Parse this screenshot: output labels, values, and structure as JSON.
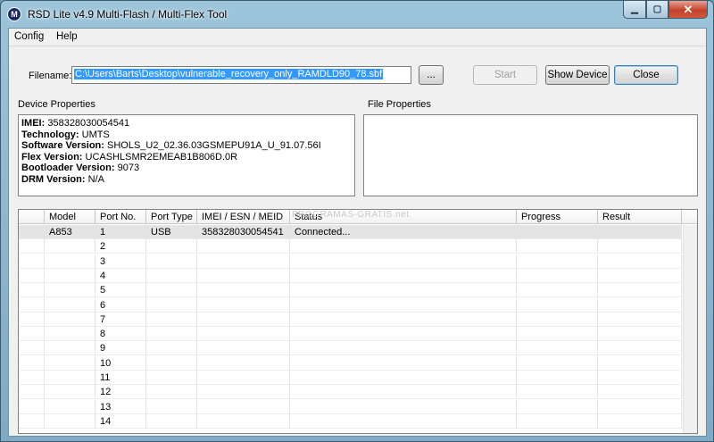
{
  "window": {
    "title": "RSD Lite v4.9 Multi-Flash / Multi-Flex Tool",
    "icon_glyph": "M",
    "minimize_glyph": "▁",
    "maximize_glyph": "▢",
    "close_glyph": "✕"
  },
  "menu": [
    "Config",
    "Help"
  ],
  "filename": {
    "label": "Filename:",
    "value": "C:\\Users\\Barts\\Desktop\\vulnerable_recovery_only_RAMDLD90_78.sbf",
    "browse_label": "..."
  },
  "buttons": {
    "start": "Start",
    "show_device": "Show Device",
    "close": "Close"
  },
  "device_properties": {
    "title": "Device Properties",
    "items": [
      {
        "key": "IMEI:",
        "value": "358328030054541"
      },
      {
        "key": "Technology:",
        "value": "UMTS"
      },
      {
        "key": "Software Version:",
        "value": "SHOLS_U2_02.36.03GSMEPU91A_U_91.07.56I"
      },
      {
        "key": "Flex Version:",
        "value": "UCASHLSMR2EMEAB1B806D.0R"
      },
      {
        "key": "Bootloader Version:",
        "value": "9073"
      },
      {
        "key": "DRM Version:",
        "value": "N/A"
      }
    ]
  },
  "file_properties": {
    "title": "File Properties"
  },
  "grid": {
    "watermark": "PROGRAMAS-GRATIS.net",
    "columns": [
      "",
      "Model",
      "Port No.",
      "Port Type",
      "IMEI / ESN / MEID",
      "Status",
      "Progress",
      "Result"
    ],
    "rows": [
      [
        "",
        "A853",
        "1",
        "USB",
        "358328030054541",
        "Connected...",
        "",
        ""
      ],
      [
        "",
        "",
        "2",
        "",
        "",
        "",
        "",
        ""
      ],
      [
        "",
        "",
        "3",
        "",
        "",
        "",
        "",
        ""
      ],
      [
        "",
        "",
        "4",
        "",
        "",
        "",
        "",
        ""
      ],
      [
        "",
        "",
        "5",
        "",
        "",
        "",
        "",
        ""
      ],
      [
        "",
        "",
        "6",
        "",
        "",
        "",
        "",
        ""
      ],
      [
        "",
        "",
        "7",
        "",
        "",
        "",
        "",
        ""
      ],
      [
        "",
        "",
        "8",
        "",
        "",
        "",
        "",
        ""
      ],
      [
        "",
        "",
        "9",
        "",
        "",
        "",
        "",
        ""
      ],
      [
        "",
        "",
        "10",
        "",
        "",
        "",
        "",
        ""
      ],
      [
        "",
        "",
        "11",
        "",
        "",
        "",
        "",
        ""
      ],
      [
        "",
        "",
        "12",
        "",
        "",
        "",
        "",
        ""
      ],
      [
        "",
        "",
        "13",
        "",
        "",
        "",
        "",
        ""
      ],
      [
        "",
        "",
        "14",
        "",
        "",
        "",
        "",
        ""
      ]
    ]
  }
}
